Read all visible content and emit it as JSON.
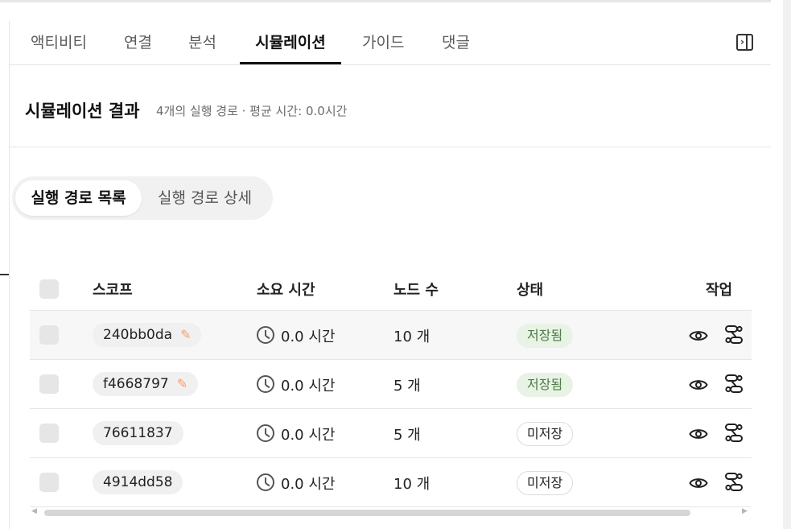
{
  "tabs": [
    "액티비티",
    "연결",
    "분석",
    "시뮬레이션",
    "가이드",
    "댓글"
  ],
  "active_tab": "시뮬레이션",
  "panel_toggle_icon": "sidebar-collapse-icon",
  "section": {
    "title": "시뮬레이션 결과",
    "subtitle": "4개의 실행 경로 · 평균 시간: 0.0시간"
  },
  "segmented": {
    "list": "실행 경로 목록",
    "detail": "실행 경로 상세",
    "active": "실행 경로 목록"
  },
  "table": {
    "headers": {
      "scope": "스코프",
      "duration": "소요 시간",
      "nodes": "노드 수",
      "status": "상태",
      "actions": "작업"
    },
    "rows": [
      {
        "scope": "240bb0da",
        "editable": true,
        "duration": "0.0 시간",
        "nodes": "10 개",
        "status": "저장됨",
        "status_type": "saved",
        "highlight": true
      },
      {
        "scope": "f4668797",
        "editable": true,
        "duration": "0.0 시간",
        "nodes": "5 개",
        "status": "저장됨",
        "status_type": "saved",
        "highlight": false
      },
      {
        "scope": "76611837",
        "editable": false,
        "duration": "0.0 시간",
        "nodes": "5 개",
        "status": "미저장",
        "status_type": "unsaved",
        "highlight": false
      },
      {
        "scope": "4914dd58",
        "editable": false,
        "duration": "0.0 시간",
        "nodes": "10 개",
        "status": "미저장",
        "status_type": "unsaved",
        "highlight": false
      }
    ]
  },
  "colors": {
    "saved_bg": "#e8f3e6",
    "saved_text": "#4d7b45",
    "pencil": "#f0a070"
  }
}
